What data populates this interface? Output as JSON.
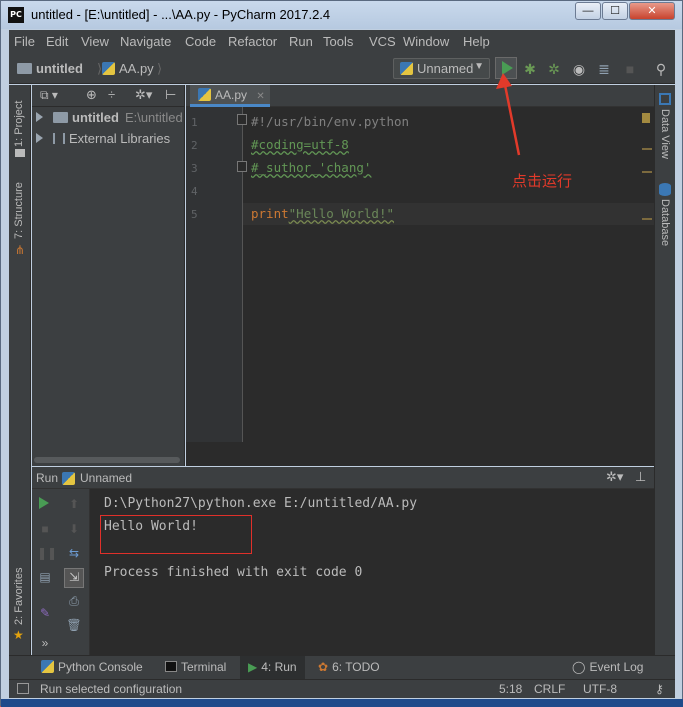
{
  "window": {
    "title": "untitled - [E:\\untitled] - ...\\AA.py - PyCharm 2017.2.4",
    "app_icon": "PC",
    "min_label": "—",
    "max_label": "☐",
    "close_label": "✕"
  },
  "menu": [
    "File",
    "Edit",
    "View",
    "Navigate",
    "Code",
    "Refactor",
    "Run",
    "Tools",
    "VCS",
    "Window",
    "Help"
  ],
  "breadcrumb": {
    "project": "untitled",
    "file": "AA.py"
  },
  "toolbar": {
    "run_config": "Unnamed"
  },
  "left_stripe": {
    "project_tab": "1: Project",
    "structure_tab": "7: Structure",
    "favorites_tab": "2: Favorites"
  },
  "right_stripe": {
    "data_view_tab": "Data View",
    "database_tab": "Database"
  },
  "project_tree": {
    "root_name": "untitled",
    "root_path": "E:\\untitled",
    "external": "External Libraries"
  },
  "editor": {
    "tab_label": "AA.py",
    "line_numbers": [
      "1",
      "2",
      "3",
      "4",
      "5"
    ],
    "line1": "#!/usr/bin/env.python",
    "line2": "#coding=utf-8",
    "line3": "#_suthor_'chang'",
    "line5_kw": "print",
    "line5_str": "\"Hello World!\""
  },
  "annotation": "点击运行",
  "run_panel": {
    "title": "Run",
    "config": "Unnamed",
    "cmd": "D:\\Python27\\python.exe E:/untitled/AA.py",
    "output": "Hello World!",
    "exit_msg": "Process finished with exit code 0"
  },
  "bottom_tabs": {
    "python_console": "Python Console",
    "terminal": "Terminal",
    "run": "4: Run",
    "todo": "6: TODO",
    "event_log": "Event Log"
  },
  "status": {
    "message": "Run selected configuration",
    "position": "5:18",
    "line_sep": "CRLF",
    "encoding": "UTF-8"
  },
  "colors": {
    "accent_green": "#499c54",
    "annotation_red": "#e23a2a"
  }
}
